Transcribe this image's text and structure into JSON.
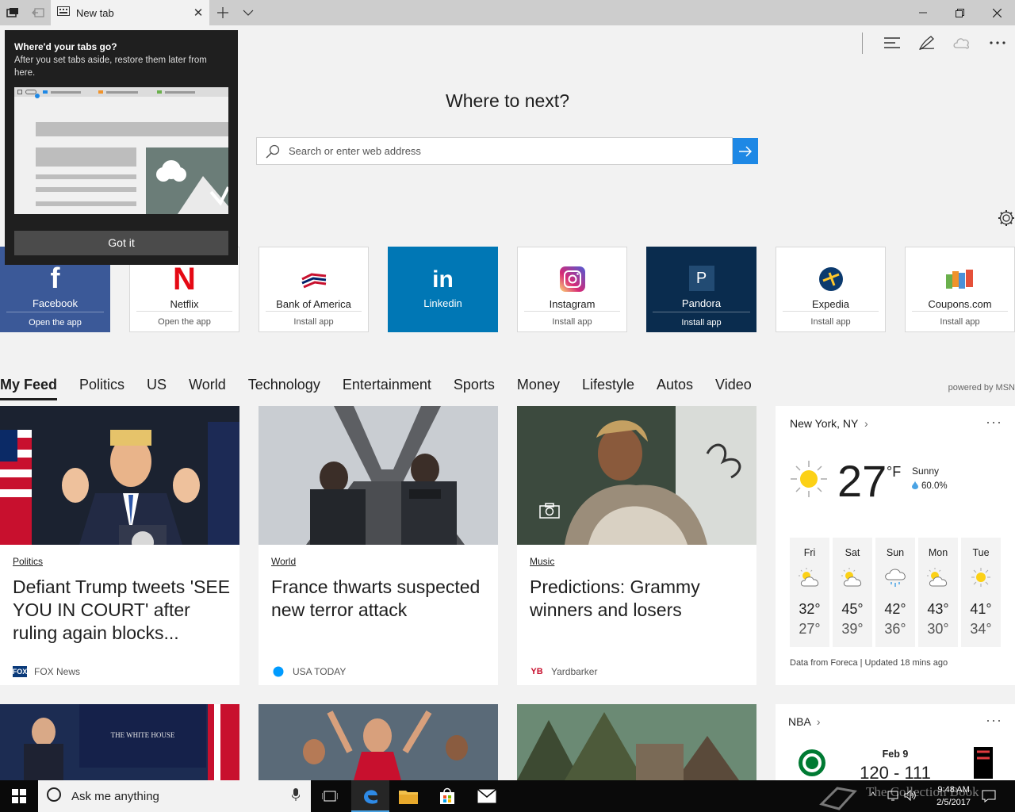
{
  "tab": {
    "title": "New tab"
  },
  "headline": "Where to next?",
  "search": {
    "placeholder": "Search or enter web address"
  },
  "tooltip": {
    "title": "Where'd your tabs go?",
    "body": "After you set tabs aside, restore them later from here.",
    "button": "Got it"
  },
  "top_sites": [
    {
      "name": "Facebook",
      "action": "Open the app",
      "bg": "#3b5998"
    },
    {
      "name": "Netflix",
      "action": "Open the app",
      "bg": "#ffffff"
    },
    {
      "name": "Bank of America",
      "action": "Install app",
      "bg": "#ffffff"
    },
    {
      "name": "Linkedin",
      "action": "",
      "bg": "#0077b5"
    },
    {
      "name": "Instagram",
      "action": "Install app",
      "bg": "#ffffff"
    },
    {
      "name": "Pandora",
      "action": "Install app",
      "bg": "#0a2c4e"
    },
    {
      "name": "Expedia",
      "action": "Install app",
      "bg": "#ffffff"
    },
    {
      "name": "Coupons.com",
      "action": "Install app",
      "bg": "#ffffff"
    }
  ],
  "feed_nav": [
    "My Feed",
    "Politics",
    "US",
    "World",
    "Technology",
    "Entertainment",
    "Sports",
    "Money",
    "Lifestyle",
    "Autos",
    "Video"
  ],
  "powered_by": "powered by MSN",
  "cards": [
    {
      "category": "Politics",
      "title": "Defiant Trump tweets 'SEE YOU IN COURT' after ruling again blocks...",
      "source": "FOX News"
    },
    {
      "category": "World",
      "title": "France thwarts suspected new terror attack",
      "source": "USA TODAY"
    },
    {
      "category": "Music",
      "title": "Predictions: Grammy winners and losers",
      "source": "Yardbarker"
    }
  ],
  "weather": {
    "location": "New York, NY",
    "temp": "27",
    "unit": "°F",
    "condition": "Sunny",
    "precip": "60.0%",
    "days": [
      {
        "name": "Fri",
        "hi": "32°",
        "lo": "27°",
        "icon": "partly-sunny"
      },
      {
        "name": "Sat",
        "hi": "45°",
        "lo": "39°",
        "icon": "partly-sunny"
      },
      {
        "name": "Sun",
        "hi": "42°",
        "lo": "36°",
        "icon": "rain-cloud"
      },
      {
        "name": "Mon",
        "hi": "43°",
        "lo": "30°",
        "icon": "partly-sunny"
      },
      {
        "name": "Tue",
        "hi": "41°",
        "lo": "34°",
        "icon": "sunny"
      }
    ],
    "footer": "Data from Foreca | Updated 18 mins ago"
  },
  "nba": {
    "title": "NBA",
    "date": "Feb 9",
    "score": "120 - 111"
  },
  "taskbar": {
    "cortana": "Ask me anything",
    "time": "9:48 AM",
    "date": "2/5/2017"
  },
  "watermark": "The Collection Book"
}
